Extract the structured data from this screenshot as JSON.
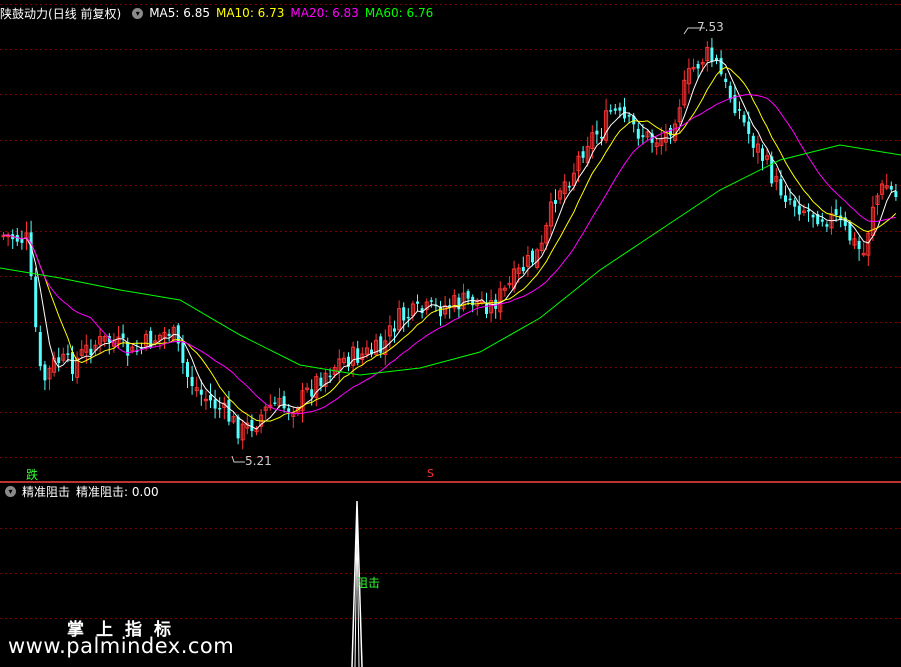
{
  "main_panel": {
    "title": "陕鼓动力",
    "title_suffix": "(日线 前复权)",
    "ma_labels": [
      {
        "text": "MA5: 6.85",
        "color": "#ffffff"
      },
      {
        "text": "MA10: 6.73",
        "color": "#ffff00"
      },
      {
        "text": "MA20: 6.83",
        "color": "#ff00ff"
      },
      {
        "text": "MA60: 6.76",
        "color": "#00ff00"
      }
    ],
    "high_label": "7.53",
    "low_label": "5.21",
    "signal_fall": "跌",
    "signal_s": "S"
  },
  "sub_panel": {
    "indicator_name": "精准阻击",
    "indicator_value": "精准阻击: 0.00",
    "signal_label": "阻击"
  },
  "watermark": {
    "cn": "掌上指标",
    "url": "www.palmindex.com"
  },
  "colors": {
    "up": "#ff3232",
    "down": "#54ffff",
    "grid": "#800000",
    "ma5": "#ffffff",
    "ma10": "#ffff00",
    "ma20": "#ff00ff",
    "ma60": "#00ff00"
  },
  "chart_data": {
    "type": "candlestick",
    "price_high": 7.53,
    "price_low": 5.21,
    "indicator": {
      "name": "精准阻击",
      "value": 0.0,
      "spike_label": "阻击"
    }
  }
}
